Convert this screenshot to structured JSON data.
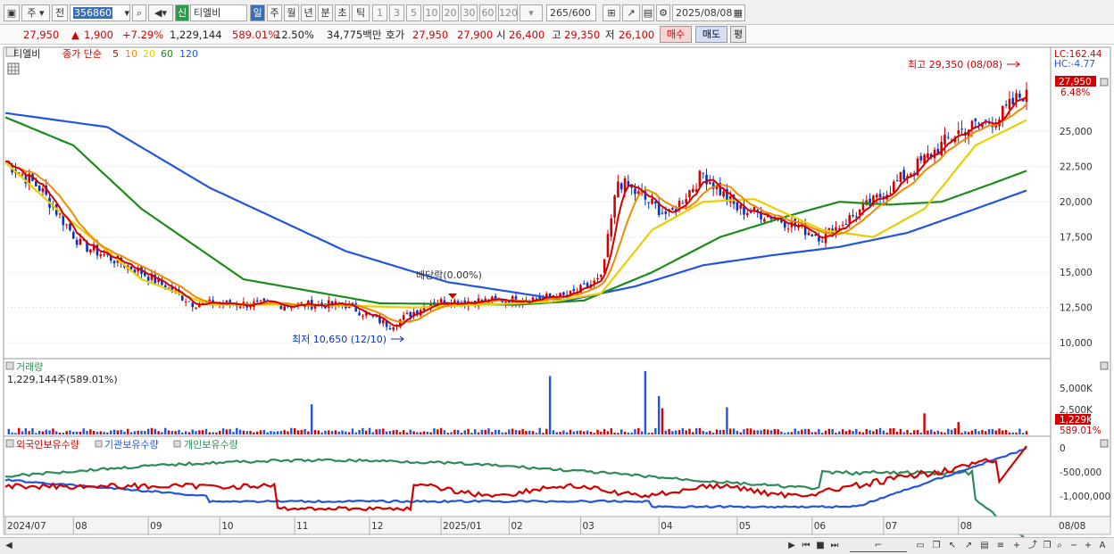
{
  "toolbar": {
    "market": "주",
    "prev": "전",
    "code": "356860",
    "credit_badge": "신",
    "stock_name": "티엘비",
    "periods": [
      "일",
      "주",
      "월",
      "년",
      "분",
      "초",
      "틱"
    ],
    "intervals": [
      "1",
      "3",
      "5",
      "10",
      "20",
      "30",
      "60",
      "120"
    ],
    "count": "265",
    "count_total": "/600",
    "date": "2025/08/08"
  },
  "quote": {
    "price": "27,950",
    "change": "1,900",
    "change_pct": "+7.29%",
    "volume": "1,229,144",
    "volume_ratio": "589.01%",
    "turnover": "12.50%",
    "amount": "34,775백만",
    "ask_label": "호가",
    "ask": "27,950",
    "bid": "27,900",
    "open_label": "시",
    "open": "26,400",
    "high_label": "고",
    "high": "29,350",
    "low_label": "저",
    "low": "26,100",
    "buy_label": "매수",
    "sell_label": "매도",
    "eval_label": "평"
  },
  "chart_data": {
    "type": "line",
    "legend": {
      "name": "티엘비",
      "series_label": "종가 단순",
      "ma_periods": [
        "5",
        "10",
        "20",
        "60",
        "120"
      ],
      "colors": [
        "#d40000",
        "#f08a00",
        "#e8d000",
        "#1a8c1a",
        "#2255dd"
      ]
    },
    "right_info": {
      "lc": "LC:162.44",
      "hc": "HC:-4.77"
    },
    "price_badge": "27,950",
    "price_pct": "6.48%",
    "y_ticks": [
      "25,000",
      "22,500",
      "20,000",
      "17,500",
      "15,000",
      "12,500",
      "10,000"
    ],
    "ylim": [
      9000,
      30900
    ],
    "annotations": {
      "high": "최고 29,350 (08/08)",
      "low": "최저 10,650 (12/10)",
      "dividend": "배당락(0.00%)"
    },
    "x_labels": [
      "2024/07",
      "08",
      "09",
      "10",
      "11",
      "12",
      "2025/01",
      "02",
      "03",
      "04",
      "05",
      "06",
      "07",
      "08",
      "08/08"
    ],
    "close_anchors": [
      [
        0,
        22900
      ],
      [
        10,
        21000
      ],
      [
        22,
        17000
      ],
      [
        40,
        15000
      ],
      [
        55,
        12800
      ],
      [
        80,
        12700
      ],
      [
        100,
        12700
      ],
      [
        113,
        11200
      ],
      [
        125,
        12900
      ],
      [
        145,
        13000
      ],
      [
        165,
        13300
      ],
      [
        175,
        14500
      ],
      [
        180,
        21500
      ],
      [
        195,
        19000
      ],
      [
        205,
        22000
      ],
      [
        215,
        19500
      ],
      [
        225,
        19000
      ],
      [
        240,
        17500
      ],
      [
        255,
        20000
      ],
      [
        270,
        23000
      ],
      [
        280,
        25000
      ],
      [
        292,
        26000
      ],
      [
        300,
        27950
      ]
    ],
    "ma20_anchors": [
      [
        0,
        22800
      ],
      [
        15,
        19500
      ],
      [
        40,
        14500
      ],
      [
        60,
        12700
      ],
      [
        90,
        12700
      ],
      [
        120,
        12500
      ],
      [
        160,
        12900
      ],
      [
        175,
        13500
      ],
      [
        190,
        18000
      ],
      [
        205,
        20000
      ],
      [
        220,
        20200
      ],
      [
        240,
        18000
      ],
      [
        255,
        17500
      ],
      [
        270,
        19500
      ],
      [
        285,
        24000
      ],
      [
        300,
        25800
      ]
    ],
    "ma60_anchors": [
      [
        0,
        26000
      ],
      [
        20,
        24000
      ],
      [
        40,
        19500
      ],
      [
        70,
        14500
      ],
      [
        110,
        12800
      ],
      [
        150,
        12700
      ],
      [
        170,
        13000
      ],
      [
        190,
        15000
      ],
      [
        210,
        17500
      ],
      [
        230,
        19000
      ],
      [
        245,
        20000
      ],
      [
        260,
        19800
      ],
      [
        275,
        20000
      ],
      [
        290,
        21300
      ],
      [
        300,
        22200
      ]
    ],
    "ma120_anchors": [
      [
        0,
        26300
      ],
      [
        30,
        25300
      ],
      [
        60,
        21000
      ],
      [
        100,
        16500
      ],
      [
        130,
        14300
      ],
      [
        165,
        13000
      ],
      [
        185,
        14000
      ],
      [
        205,
        15500
      ],
      [
        225,
        16200
      ],
      [
        245,
        16800
      ],
      [
        265,
        17800
      ],
      [
        285,
        19500
      ],
      [
        300,
        20800
      ]
    ],
    "volume": {
      "title": "거래량",
      "value": "1,229,144주(589.01%)",
      "y_ticks": [
        "5,000K",
        "2,500K"
      ],
      "badge": "1,229K",
      "badge_pct": "589.01%",
      "spikes": [
        [
          90,
          3000
        ],
        [
          160,
          5800
        ],
        [
          188,
          6300
        ],
        [
          192,
          3800
        ],
        [
          193,
          2600
        ],
        [
          212,
          2700
        ],
        [
          270,
          2100
        ],
        [
          280,
          1229
        ]
      ]
    },
    "holdings": {
      "titles": [
        "외국인보유수량",
        "기관보유수량",
        "개인보유수량"
      ],
      "colors": [
        "#d40000",
        "#2255dd",
        "#2e8b57"
      ],
      "y_ticks": [
        "0",
        "-500,000",
        "-1,000,000"
      ]
    }
  }
}
